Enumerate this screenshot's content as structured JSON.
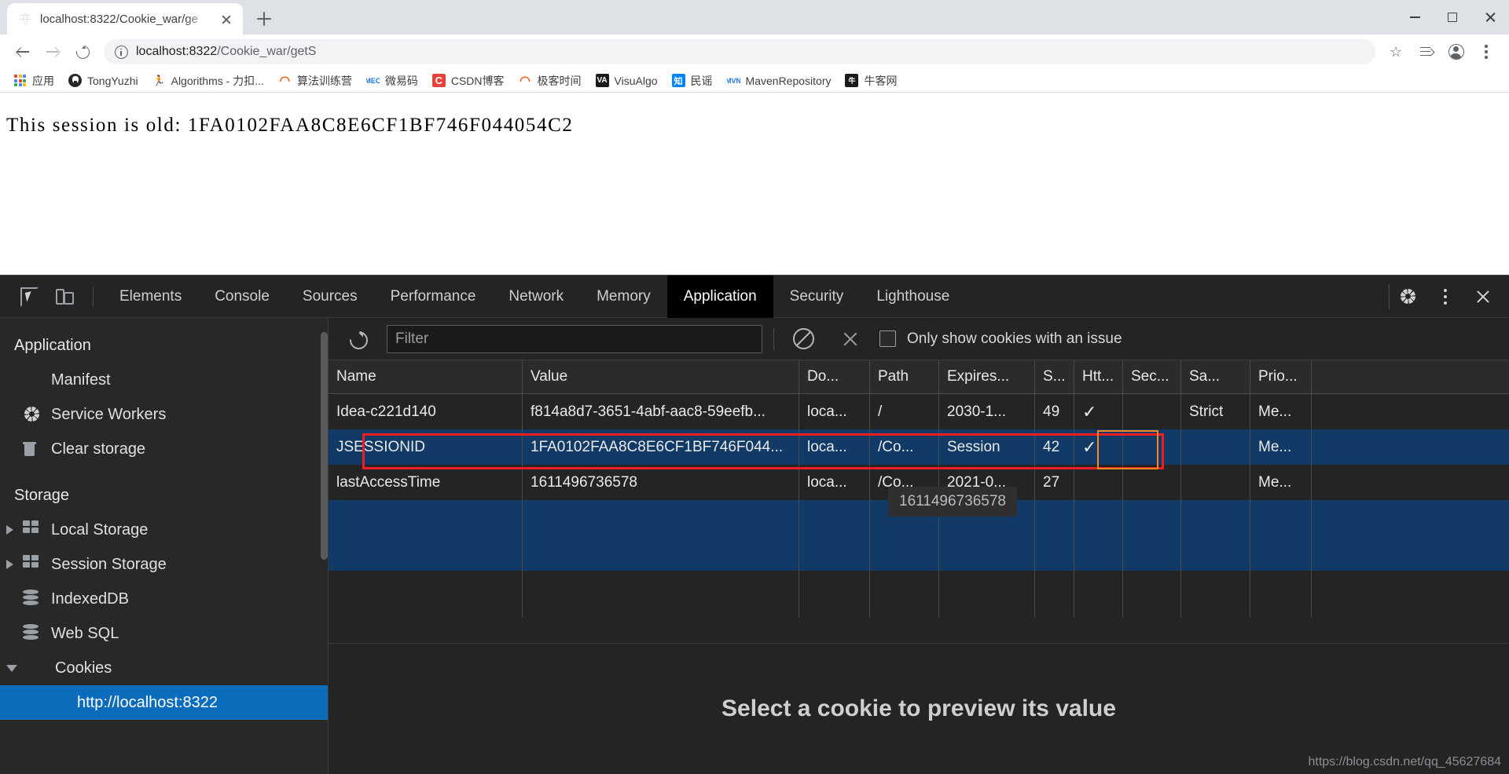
{
  "browser": {
    "tab": {
      "title": "localhost:8322/Cookie_war/ge",
      "favicon": "globe-icon"
    },
    "newtab_tooltip": "New Tab",
    "address": {
      "scheme_host": "localhost:8322",
      "path": "/Cookie_war/getS",
      "full": "localhost:8322/Cookie_war/getS"
    },
    "window_controls": {
      "minimize": "minimize",
      "maximize": "maximize",
      "close": "close"
    },
    "bookmarks": [
      {
        "label": "应用",
        "icon": "apps-grid-icon"
      },
      {
        "label": "TongYuzhi",
        "icon": "github-icon"
      },
      {
        "label": "Algorithms - 力扣...",
        "icon": "leetcode-icon"
      },
      {
        "label": "算法训练营",
        "icon": "orange-circle-icon"
      },
      {
        "label": "微易码",
        "icon": "mec-icon"
      },
      {
        "label": "CSDN博客",
        "icon": "csdn-icon"
      },
      {
        "label": "极客时间",
        "icon": "geek-icon"
      },
      {
        "label": "VisuAlgo",
        "icon": "visualgo-icon"
      },
      {
        "label": "民谣",
        "icon": "zhihu-icon"
      },
      {
        "label": "MavenRepository",
        "icon": "maven-icon"
      },
      {
        "label": "牛客网",
        "icon": "nowcoder-icon"
      }
    ]
  },
  "page": {
    "body_text": "This session is old: 1FA0102FAA8C8E6CF1BF746F044054C2"
  },
  "devtools": {
    "toolbar_icons": {
      "inspect": "inspect-element-icon",
      "device": "device-toolbar-icon"
    },
    "tabs": [
      {
        "label": "Elements",
        "active": false
      },
      {
        "label": "Console",
        "active": false
      },
      {
        "label": "Sources",
        "active": false
      },
      {
        "label": "Performance",
        "active": false
      },
      {
        "label": "Network",
        "active": false
      },
      {
        "label": "Memory",
        "active": false
      },
      {
        "label": "Application",
        "active": true
      },
      {
        "label": "Security",
        "active": false
      },
      {
        "label": "Lighthouse",
        "active": false
      }
    ],
    "right_icons": {
      "settings": "gear-icon",
      "more": "more-vertical-icon",
      "close": "close-icon"
    },
    "sidebar": {
      "sections": [
        {
          "title": "Application",
          "items": [
            {
              "label": "Manifest",
              "icon": "document-icon",
              "twisty": "none",
              "selected": false
            },
            {
              "label": "Service Workers",
              "icon": "gear-icon",
              "twisty": "none",
              "selected": false
            },
            {
              "label": "Clear storage",
              "icon": "trash-icon",
              "twisty": "none",
              "selected": false
            }
          ]
        },
        {
          "title": "Storage",
          "items": [
            {
              "label": "Local Storage",
              "icon": "grid-icon",
              "twisty": "collapsed",
              "selected": false
            },
            {
              "label": "Session Storage",
              "icon": "grid-icon",
              "twisty": "collapsed",
              "selected": false
            },
            {
              "label": "IndexedDB",
              "icon": "database-icon",
              "twisty": "none",
              "selected": false
            },
            {
              "label": "Web SQL",
              "icon": "database-icon",
              "twisty": "none",
              "selected": false
            },
            {
              "label": "Cookies",
              "icon": "cookie-icon",
              "twisty": "expanded",
              "selected": false
            },
            {
              "label": "http://localhost:8322",
              "icon": "cookie-icon",
              "twisty": "none",
              "selected": true
            }
          ]
        }
      ]
    },
    "cookie_toolbar": {
      "refresh_icon": "refresh-icon",
      "filter_placeholder": "Filter",
      "filter_value": "",
      "clear_all_icon": "clear-all-cookies-icon",
      "clear_filtered_icon": "clear-filtered-cookies-icon",
      "issue_checkbox_label": "Only show cookies with an issue",
      "issue_checkbox_checked": false
    },
    "cookie_table": {
      "columns": [
        "Name",
        "Value",
        "Do...",
        "Path",
        "Expires...",
        "S...",
        "Htt...",
        "Sec...",
        "Sa...",
        "Prio..."
      ],
      "rows": [
        {
          "name": "Idea-c221d140",
          "value": "f814a8d7-3651-4abf-aac8-59eefb...",
          "domain": "loca...",
          "path": "/",
          "expires": "2030-1...",
          "size": "49",
          "httponly": "✓",
          "secure": "",
          "samesite": "Strict",
          "priority": "Me...",
          "selected": false,
          "highlighted": false
        },
        {
          "name": "JSESSIONID",
          "value": "1FA0102FAA8C8E6CF1BF746F044...",
          "domain": "loca...",
          "path": "/Co...",
          "expires": "Session",
          "size": "42",
          "httponly": "✓",
          "secure": "",
          "samesite": "",
          "priority": "Me...",
          "selected": true,
          "highlighted": true
        },
        {
          "name": "lastAccessTime",
          "value": "1611496736578",
          "domain": "loca...",
          "path": "/Co...",
          "expires": "2021-0...",
          "size": "27",
          "httponly": "",
          "secure": "",
          "samesite": "",
          "priority": "Me...",
          "selected": false,
          "highlighted": false
        }
      ],
      "tooltip_value": "1611496736578"
    },
    "preview": {
      "empty_message": "Select a cookie to preview its value"
    },
    "watermark": "https://blog.csdn.net/qq_45627684"
  },
  "colors": {
    "devtools_bg": "#242424",
    "selected_row": "#123a66",
    "sidebar_selected": "#0b6cbb",
    "red_highlight": "#ee1c25",
    "orange_highlight": "#f08a24",
    "tab_active_bg": "#000000"
  }
}
